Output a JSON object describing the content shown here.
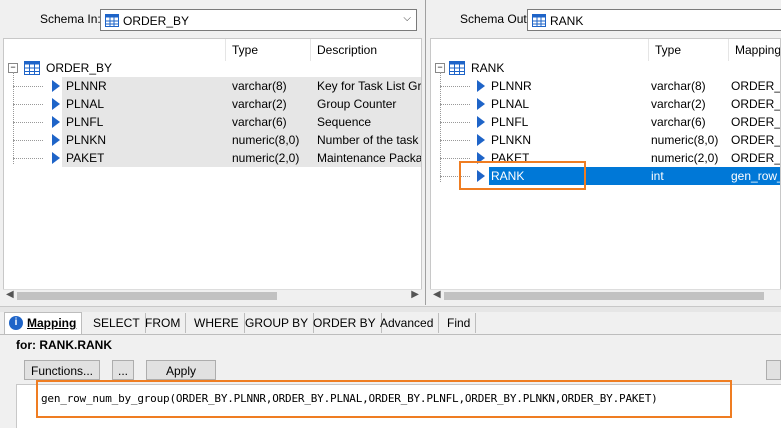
{
  "schema_in": {
    "label": "Schema In:",
    "selected": "ORDER_BY",
    "columns": [
      "Type",
      "Description"
    ],
    "root": "ORDER_BY",
    "rows": [
      {
        "name": "PLNNR",
        "type": "varchar(8)",
        "desc": "Key for Task List Gro"
      },
      {
        "name": "PLNAL",
        "type": "varchar(2)",
        "desc": "Group Counter"
      },
      {
        "name": "PLNFL",
        "type": "varchar(6)",
        "desc": "Sequence"
      },
      {
        "name": "PLNKN",
        "type": "numeric(8,0)",
        "desc": "Number of the task"
      },
      {
        "name": "PAKET",
        "type": "numeric(2,0)",
        "desc": "Maintenance Packag"
      }
    ]
  },
  "schema_out": {
    "label": "Schema Out:",
    "selected": "RANK",
    "columns": [
      "Type",
      "Mapping"
    ],
    "root": "RANK",
    "rows": [
      {
        "name": "PLNNR",
        "type": "varchar(8)",
        "mapping": "ORDER_BY"
      },
      {
        "name": "PLNAL",
        "type": "varchar(2)",
        "mapping": "ORDER_BY"
      },
      {
        "name": "PLNFL",
        "type": "varchar(6)",
        "mapping": "ORDER_BY"
      },
      {
        "name": "PLNKN",
        "type": "numeric(8,0)",
        "mapping": "ORDER_BY"
      },
      {
        "name": "PAKET",
        "type": "numeric(2,0)",
        "mapping": "ORDER_BY"
      },
      {
        "name": "RANK",
        "type": "int",
        "mapping": "gen_row_"
      }
    ]
  },
  "tabs": [
    "Mapping",
    "SELECT",
    "FROM",
    "WHERE",
    "GROUP BY",
    "ORDER BY",
    "Advanced",
    "Find"
  ],
  "for_label": "for: RANK.RANK",
  "buttons": {
    "functions": "Functions...",
    "ellipsis": "...",
    "apply": "Apply"
  },
  "expression": "gen_row_num_by_group(ORDER_BY.PLNNR,ORDER_BY.PLNAL,ORDER_BY.PLNFL,ORDER_BY.PLNKN,ORDER_BY.PAKET)",
  "colors": {
    "highlight": "#ef7d22",
    "selection": "#0078d7",
    "arrow": "#1e64c8"
  }
}
